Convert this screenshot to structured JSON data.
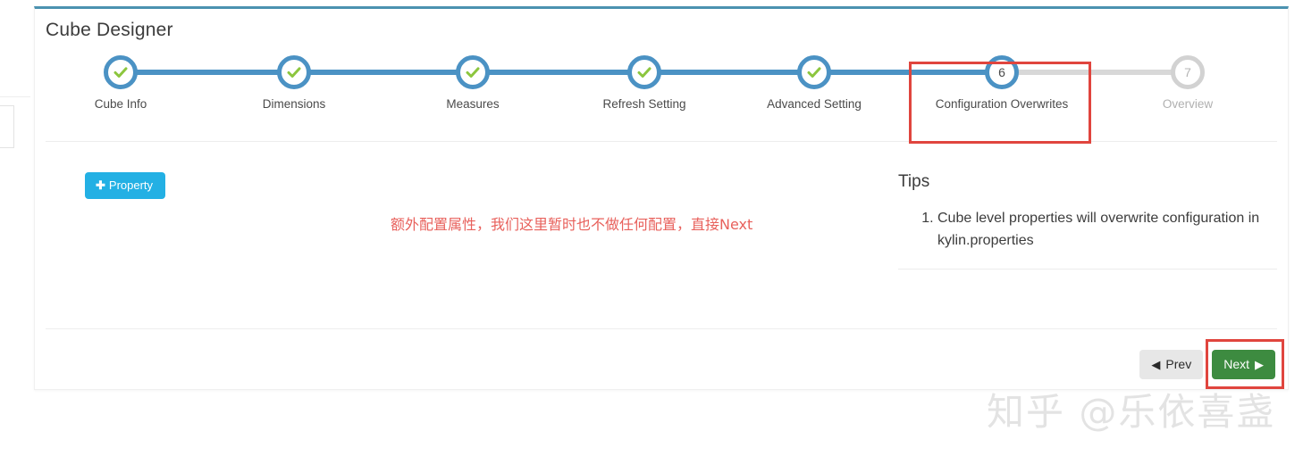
{
  "page": {
    "title": "Cube Designer",
    "accent_blue": "#4b92c4",
    "panel_top_border": "#4b92b0",
    "highlight_red": "#e0453e",
    "annotation_red": "#e8615c"
  },
  "stepper": {
    "steps": [
      {
        "index": 1,
        "label": "Cube Info",
        "state": "complete",
        "icon": "check-icon"
      },
      {
        "index": 2,
        "label": "Dimensions",
        "state": "complete",
        "icon": "check-icon"
      },
      {
        "index": 3,
        "label": "Measures",
        "state": "complete",
        "icon": "check-icon"
      },
      {
        "index": 4,
        "label": "Refresh Setting",
        "state": "complete",
        "icon": "check-icon"
      },
      {
        "index": 5,
        "label": "Advanced Setting",
        "state": "complete",
        "icon": "check-icon"
      },
      {
        "index": 6,
        "label": "Configuration Overwrites",
        "state": "active",
        "number": "6"
      },
      {
        "index": 7,
        "label": "Overview",
        "state": "inactive",
        "number": "7"
      }
    ],
    "highlighted_step": "Configuration Overwrites"
  },
  "content": {
    "property_button": {
      "label": "Property",
      "plus_icon": "plus-icon",
      "color": "#23b0e4"
    },
    "annotation": "额外配置属性，我们这里暂时也不做任何配置，直接Next"
  },
  "tips": {
    "title": "Tips",
    "items": [
      "Cube level properties will overwrite configuration in kylin.properties"
    ]
  },
  "footer": {
    "prev_label": "Prev",
    "prev_icon": "arrow-left-icon",
    "next_label": "Next",
    "next_icon": "arrow-right-icon",
    "next_color": "#3d8b40",
    "prev_color": "#e7e7e7"
  },
  "watermark": {
    "text": "知乎 @乐依喜盏"
  }
}
